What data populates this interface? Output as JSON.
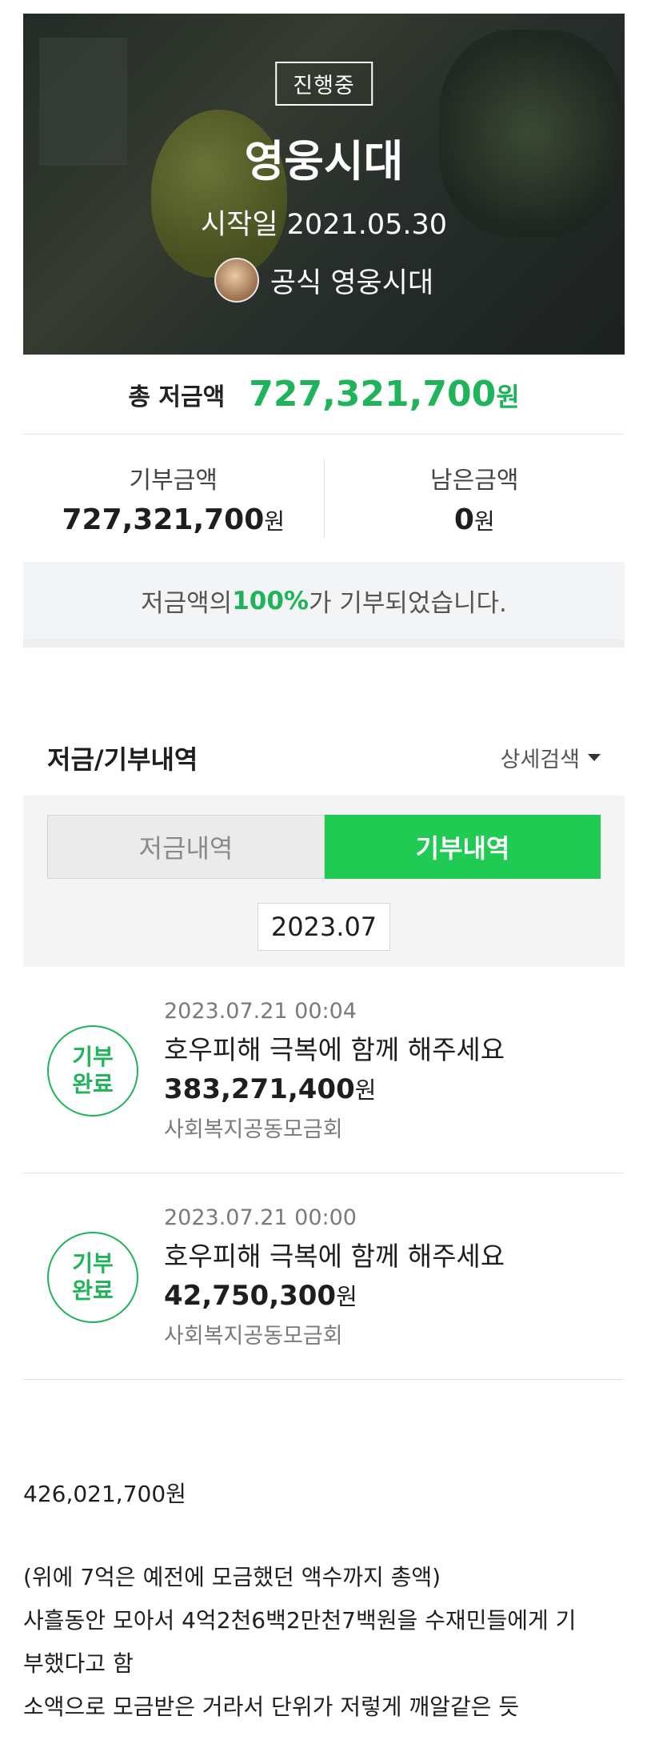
{
  "campaign": {
    "status_badge": "진행중",
    "title": "영웅시대",
    "start_date": "시작일 2021.05.30",
    "owner": "공식 영웅시대"
  },
  "summary": {
    "total_label": "총 저금액",
    "total_value": "727,321,700",
    "won": "원",
    "donated_label": "기부금액",
    "donated_value": "727,321,700",
    "remaining_label": "남은금액",
    "remaining_value": "0",
    "percent_prefix": "저금액의 ",
    "percent_value": "100%",
    "percent_suffix": "가 기부되었습니다."
  },
  "history": {
    "title": "저금/기부내역",
    "detail_search": "상세검색",
    "tabs": [
      {
        "label": "저금내역",
        "active": false
      },
      {
        "label": "기부내역",
        "active": true
      }
    ],
    "month": "2023.07",
    "entries": [
      {
        "badge_line1": "기부",
        "badge_line2": "완료",
        "time": "2023.07.21 00:04",
        "title": "호우피해 극복에 함께 해주세요",
        "amount": "383,271,400",
        "won": "원",
        "org": "사회복지공동모금회"
      },
      {
        "badge_line1": "기부",
        "badge_line2": "완료",
        "time": "2023.07.21 00:00",
        "title": "호우피해 극복에 함께 해주세요",
        "amount": "42,750,300",
        "won": "원",
        "org": "사회복지공동모금회"
      }
    ]
  },
  "post": {
    "line1": "426,021,700원",
    "line2": "(위에 7억은 예전에 모금했던 액수까지 총액)",
    "line3": "사흘동안 모아서 4억2천6백2만천7백원을 수재민들에게 기",
    "line4": "부했다고 함",
    "line5": "소액으로 모금받은 거라서 단위가 저렇게 깨알같은 듯"
  },
  "colors": {
    "accent_green": "#1fb45a",
    "tab_active": "#1fcb52"
  }
}
